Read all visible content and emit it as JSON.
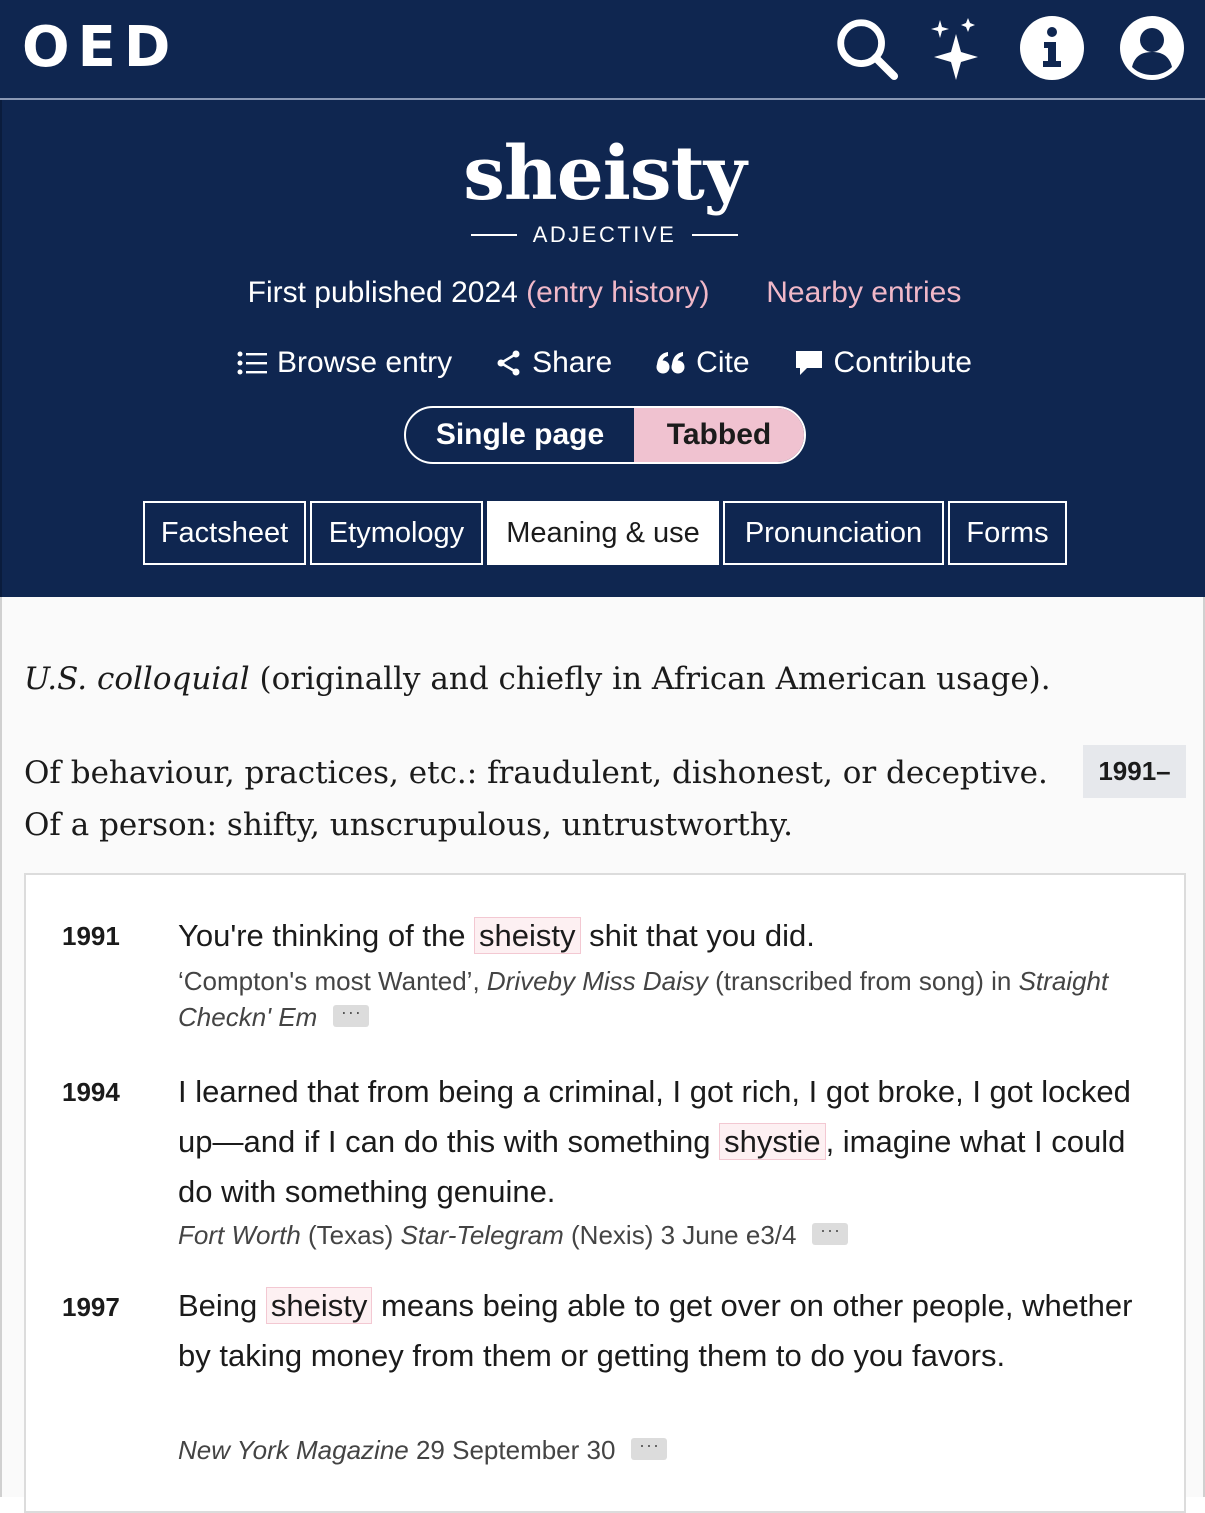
{
  "header": {
    "logo": "OED",
    "icons": [
      "search-icon",
      "sparkles-icon",
      "info-icon",
      "account-icon"
    ]
  },
  "entry": {
    "headword": "sheisty",
    "part_of_speech": "ADJECTIVE",
    "first_published": "First published 2024",
    "entry_history": "(entry history)",
    "nearby_entries": "Nearby entries",
    "actions": {
      "browse": "Browse entry",
      "share": "Share",
      "cite": "Cite",
      "contribute": "Contribute"
    },
    "view_toggle": {
      "single": "Single page",
      "tabbed": "Tabbed",
      "selected": "Tabbed"
    },
    "tabs": [
      "Factsheet",
      "Etymology",
      "Meaning & use",
      "Pronunciation",
      "Forms"
    ],
    "active_tab": "Meaning & use"
  },
  "sense": {
    "label_italic": "U.S. colloquial",
    "label_rest": " (originally and chiefly in African American usage).",
    "definition": "Of behaviour, practices, etc.: fraudulent, dishonest, or deceptive. Of a person: shifty, unscrupulous, untrustworthy.",
    "date_range": "1991–"
  },
  "quotations": [
    {
      "year": "1991",
      "text_before": "You're thinking of the ",
      "highlight": "sheisty",
      "text_after": " shit that you did.",
      "src_a": "‘Compton's most Wanted’, ",
      "src_b": "Driveby Miss Daisy",
      "src_c": " (transcribed from song) in ",
      "src_d": "Straight Checkn' Em",
      "more": "···"
    },
    {
      "year": "1994",
      "text_before": "I learned that from being a criminal, I got rich, I got broke, I got locked up—and if I can do this with something ",
      "highlight": "shystie",
      "text_after": ", imagine what I could do with something genuine.",
      "src_a": "Fort Worth",
      "src_b": " (Texas) ",
      "src_c": "Star-Telegram",
      "src_d": " (Nexis) 3 June e3/4",
      "more": "···"
    },
    {
      "year": "1997",
      "text_before": "Being ",
      "highlight": "sheisty",
      "text_after": " means being able to get over on other people, whether by taking money from them or getting them to do you favors.",
      "src_a": "New York Magazine",
      "src_b": " 29 September 30",
      "more": "···"
    }
  ],
  "colors": {
    "navy": "#0f2650",
    "pink": "#f0b8c8",
    "toggle_pink": "#f0c2d0"
  }
}
